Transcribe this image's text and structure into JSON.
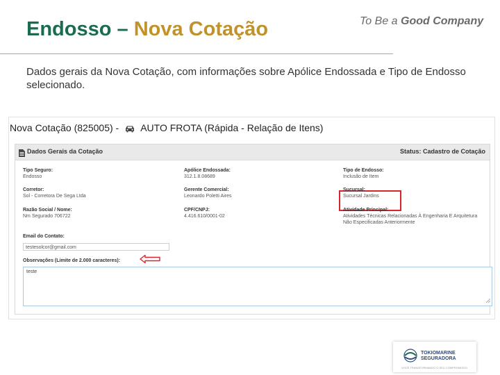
{
  "slide": {
    "title_part1": "Endosso – ",
    "title_part2": "Nova Cotação",
    "tagline_part1": "To Be a ",
    "tagline_part2": "Good Company",
    "description": "Dados gerais da Nova Cotação, com informações sobre Apólice Endossada e Tipo de Endosso selecionado."
  },
  "screen": {
    "heading_part1": "Nova Cotação (825005) -",
    "heading_part2": "AUTO FROTA (Rápida - Relação de Itens)",
    "panel_title": "Dados Gerais da Cotação",
    "status": "Status: Cadastro de Cotação",
    "fields": {
      "tipo_seguro_label": "Tipo Seguro:",
      "tipo_seguro_value": "Endosso",
      "apolice_label": "Apólice Endossada:",
      "apolice_value": "312.1.8.08689",
      "tipo_endosso_label": "Tipo de Endosso:",
      "tipo_endosso_value": "Inclusão de Item",
      "corretor_label": "Corretor:",
      "corretor_value": "Sol - Corretora De Sega Ltda",
      "gerente_label": "Gerente Comercial:",
      "gerente_value": "Leonardo Poletti Aires",
      "sucursal_label": "Sucursal:",
      "sucursal_value": "Sucursal Jardins",
      "razao_label": "Razão Social / Nome:",
      "razao_value": "Nm Segurado 706722",
      "cpf_label": "CPF/CNPJ:",
      "cpf_value": "4.416.610/0001-02",
      "atividade_label": "Atividade Principal:",
      "atividade_value_line1": "Atividades Técnicas Relacionadas À Engenharia E Arquitetura",
      "atividade_value_line2": "Não Especificadas Anteriormente",
      "email_label": "Email do Contato:",
      "email_value": "testesolcor@gmail.com",
      "obs_label": "Observações (Limite de 2.000 caracteres):",
      "obs_value": "teste"
    }
  },
  "logo": {
    "name_line1": "TOKIOMARINE",
    "name_line2": "SEGURADORA",
    "subtext": "VOCÊ TRANSFORMANDO O SEU COMPROMISSO"
  },
  "colors": {
    "title_green": "#1b6b4f",
    "title_gold": "#c0922a",
    "highlight_red": "#d9232d"
  }
}
